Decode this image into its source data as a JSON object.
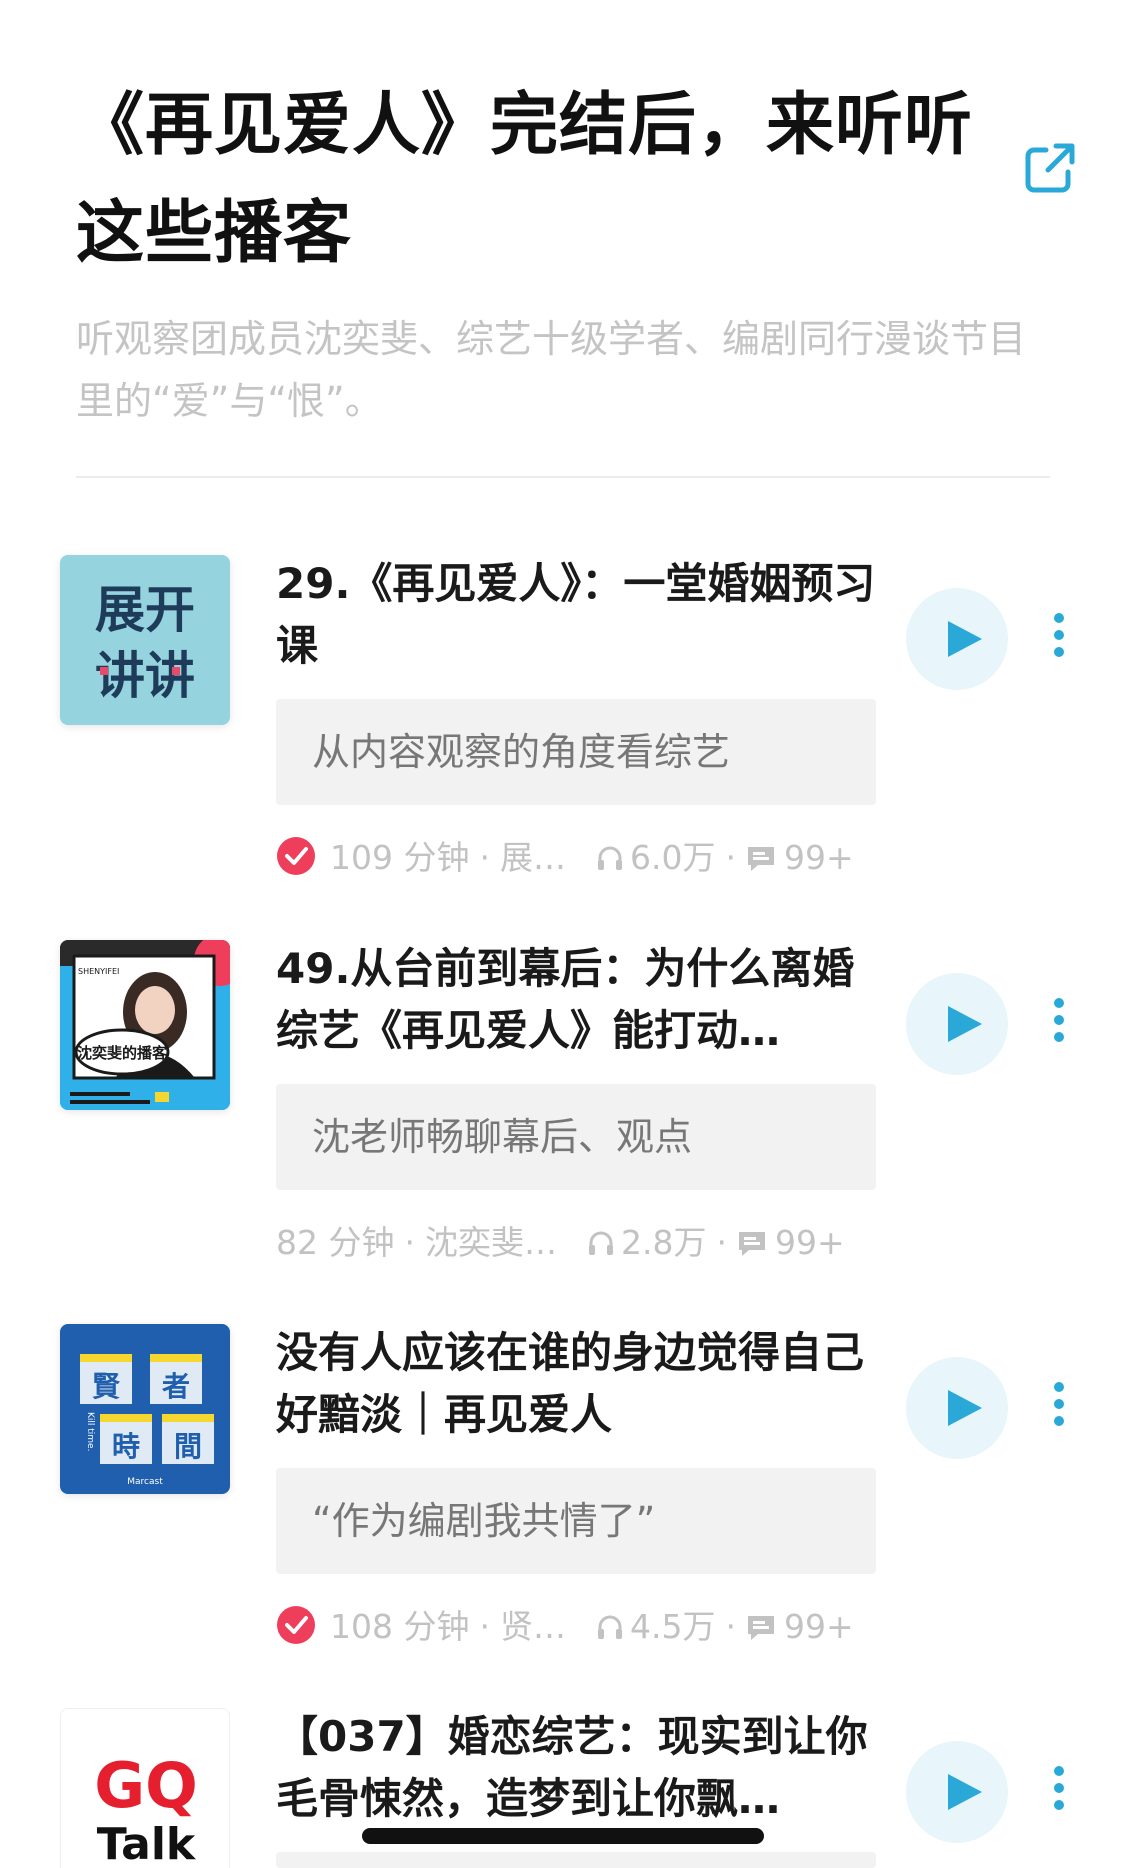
{
  "header": {
    "title": "《再见爱人》完结后，来听听这些播客",
    "subtitle": "听观察团成员沈奕斐、综艺十级学者、编剧同行漫谈节目里的“爱”与“恨”。",
    "share_icon": "share-external-icon"
  },
  "accent_color": "#2aa9d8",
  "episodes": [
    {
      "title": "29.《再见爱人》：一堂婚姻预习课",
      "quote": "从内容观察的角度看综艺",
      "verified": true,
      "duration": "109 分钟",
      "author": "展…",
      "plays": "6.0万",
      "comments": "99+",
      "cover_text": [
        "展开",
        "讲讲"
      ]
    },
    {
      "title": "49.从台前到幕后：为什么离婚综艺《再见爱人》能打动…",
      "quote": "沈老师畅聊幕后、观点",
      "verified": false,
      "duration": "82 分钟",
      "author": "沈奕斐…",
      "plays": "2.8万",
      "comments": "99+",
      "cover_text": [
        "SHENYIFEI",
        "沈奕斐的播客"
      ]
    },
    {
      "title": "没有人应该在谁的身边觉得自己好黯淡｜再见爱人",
      "quote": "“作为编剧我共情了”",
      "verified": true,
      "duration": "108 分钟",
      "author": "贤…",
      "plays": "4.5万",
      "comments": "99+",
      "cover_text": [
        "賢",
        "者",
        "時",
        "間",
        "Kill time.",
        "Marcast"
      ]
    },
    {
      "title": "【037】婚恋综艺：现实到让你毛骨悚然，造梦到让你飘…",
      "quote": "",
      "verified": false,
      "duration": "",
      "author": "",
      "plays": "",
      "comments": "",
      "cover_text": [
        "GQ",
        "Talk"
      ]
    }
  ],
  "meta_separator": "·"
}
